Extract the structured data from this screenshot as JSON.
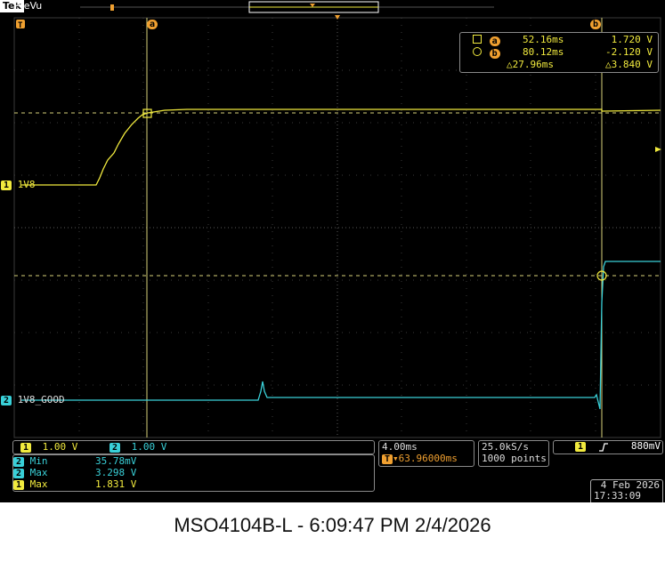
{
  "header": {
    "brand": "Tek",
    "mode": "PreVu"
  },
  "cursors": {
    "a_marker": "a",
    "b_marker": "b",
    "readout": {
      "a_time": "52.16ms",
      "a_volt": "1.720 V",
      "b_time": "80.12ms",
      "b_volt": "-2.120 V",
      "delta_time": "△27.96ms",
      "delta_volt": "△3.840 V"
    }
  },
  "channels": {
    "ch1": {
      "number": "1",
      "label": "1V8",
      "scale": "1.00 V",
      "color": "#f1ea3e"
    },
    "ch2": {
      "number": "2",
      "label": "1V8_GOOD",
      "scale": "1.00 V",
      "color": "#39d0d8"
    }
  },
  "measurements": [
    {
      "channel": "2",
      "name": "Min",
      "value": "35.78mV"
    },
    {
      "channel": "2",
      "name": "Max",
      "value": "3.298 V"
    },
    {
      "channel": "1",
      "name": "Max",
      "value": "1.831 V"
    }
  ],
  "timebase": {
    "scale": "4.00ms",
    "delay": "▾63.96000ms",
    "delay_icon": "trigger-delay-icon"
  },
  "acquisition": {
    "rate": "25.0kS/s",
    "points": "1000 points"
  },
  "trigger": {
    "source": "1",
    "slope": "rising",
    "level": "880mV",
    "marker": "T"
  },
  "datetime": {
    "date": "4 Feb 2026",
    "time": "17:33:09"
  },
  "caption": "MSO4104B-L - 6:09:47 PM   2/4/2026"
}
